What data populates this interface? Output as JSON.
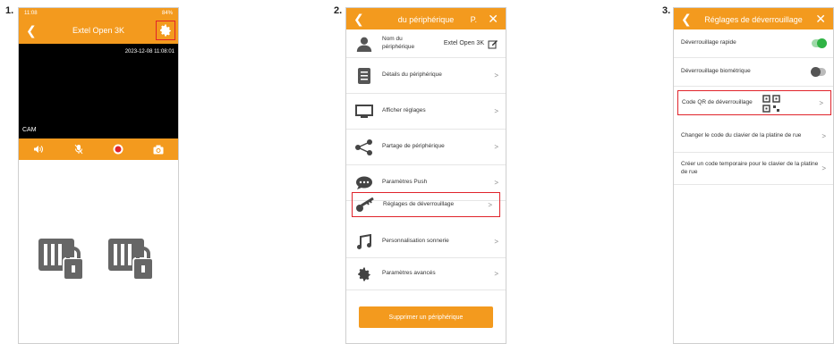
{
  "steps": [
    "1.",
    "2.",
    "3."
  ],
  "colors": {
    "accent": "#f39a1e",
    "highlight": "#e0242b",
    "toggle_on": "#2fb344",
    "toggle_off": "#555555"
  },
  "screen1": {
    "status_time": "11:08",
    "status_right": "84%",
    "title": "Extel Open 3K",
    "timestamp": "2023-12-08 11:08:01",
    "cam_label": "CAM",
    "controls": [
      "volume-icon",
      "mic-off-icon",
      "record-icon",
      "snapshot-icon"
    ],
    "settings_icon": "gear-icon",
    "lock_buttons": [
      "gate-unlock-1-icon",
      "gate-unlock-2-icon"
    ]
  },
  "screen2": {
    "title": "du périphérique",
    "title_right": "P.",
    "device_name_label": "Nom du\npériphérique",
    "device_name_value": "Extel Open 3K",
    "items": [
      {
        "label": "Détails du périphérique",
        "icon": "list-icon"
      },
      {
        "label": "Afficher réglages",
        "icon": "monitor-icon"
      },
      {
        "label": "Partage de périphérique",
        "icon": "share-icon"
      },
      {
        "label": "Paramètres Push",
        "icon": "chat-icon"
      },
      {
        "label": "Réglages de déverrouillage",
        "icon": "key-icon"
      },
      {
        "label": "Personnalisation sonnerie",
        "icon": "music-icon"
      },
      {
        "label": "Paramètres avancés",
        "icon": "settings-icon"
      }
    ],
    "delete_label": "Supprimer un périphérique"
  },
  "screen3": {
    "title": "Réglages de déverrouillage",
    "quick_unlock": {
      "label": "Déverrouillage rapide",
      "on": true
    },
    "bio_unlock": {
      "label": "Déverrouillage biométrique",
      "on": false
    },
    "qr_code": {
      "label": "Code QR de déverrouillage"
    },
    "change_code": {
      "label": "Changer le code du clavier de la platine de rue"
    },
    "temp_code": {
      "label": "Créer un code temporaire pour le clavier de la platine de rue"
    }
  }
}
